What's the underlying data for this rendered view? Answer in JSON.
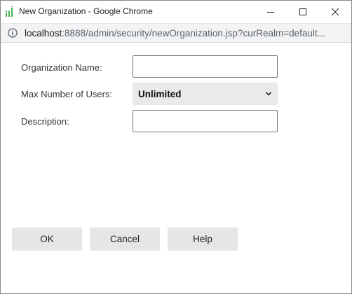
{
  "window": {
    "title": "New Organization - Google Chrome"
  },
  "address_bar": {
    "host": "localhost",
    "path": ":8888/admin/security/newOrganization.jsp?curRealm=default..."
  },
  "form": {
    "org_name": {
      "label": "Organization Name:",
      "value": ""
    },
    "max_users": {
      "label": "Max Number of Users:",
      "selected": "Unlimited"
    },
    "description": {
      "label": "Description:",
      "value": ""
    }
  },
  "buttons": {
    "ok": "OK",
    "cancel": "Cancel",
    "help": "Help"
  },
  "colors": {
    "app_icon": "#4caf50",
    "button_bg": "#e6e6e6",
    "address_bg": "#f1f3f4"
  }
}
